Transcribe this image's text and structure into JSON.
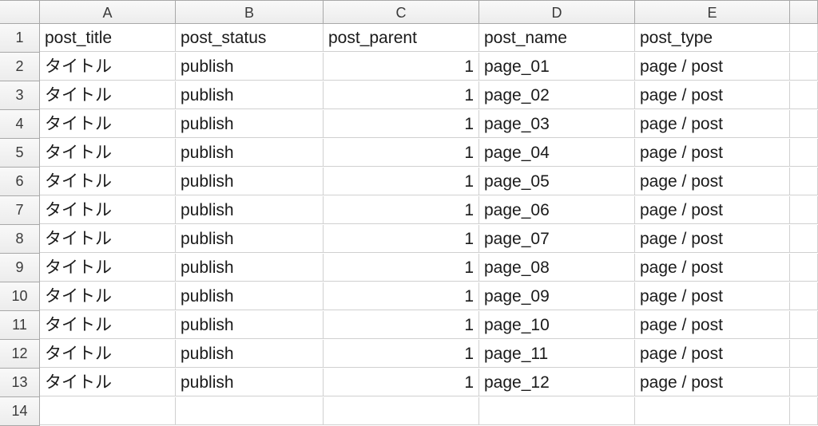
{
  "columns": [
    "A",
    "B",
    "C",
    "D",
    "E",
    ""
  ],
  "row_numbers": [
    "1",
    "2",
    "3",
    "4",
    "5",
    "6",
    "7",
    "8",
    "9",
    "10",
    "11",
    "12",
    "13",
    "14"
  ],
  "header_row": {
    "A": "post_title",
    "B": "post_status",
    "C": "post_parent",
    "D": "post_name",
    "E": "post_type"
  },
  "rows": [
    {
      "A": "タイトル",
      "B": "publish",
      "C": "1",
      "D": "page_01",
      "E": "page / post"
    },
    {
      "A": "タイトル",
      "B": "publish",
      "C": "1",
      "D": "page_02",
      "E": "page / post"
    },
    {
      "A": "タイトル",
      "B": "publish",
      "C": "1",
      "D": "page_03",
      "E": "page / post"
    },
    {
      "A": "タイトル",
      "B": "publish",
      "C": "1",
      "D": "page_04",
      "E": "page / post"
    },
    {
      "A": "タイトル",
      "B": "publish",
      "C": "1",
      "D": "page_05",
      "E": "page / post"
    },
    {
      "A": "タイトル",
      "B": "publish",
      "C": "1",
      "D": "page_06",
      "E": "page / post"
    },
    {
      "A": "タイトル",
      "B": "publish",
      "C": "1",
      "D": "page_07",
      "E": "page / post"
    },
    {
      "A": "タイトル",
      "B": "publish",
      "C": "1",
      "D": "page_08",
      "E": "page / post"
    },
    {
      "A": "タイトル",
      "B": "publish",
      "C": "1",
      "D": "page_09",
      "E": "page / post"
    },
    {
      "A": "タイトル",
      "B": "publish",
      "C": "1",
      "D": "page_10",
      "E": "page / post"
    },
    {
      "A": "タイトル",
      "B": "publish",
      "C": "1",
      "D": "page_11",
      "E": "page / post"
    },
    {
      "A": "タイトル",
      "B": "publish",
      "C": "1",
      "D": "page_12",
      "E": "page / post"
    }
  ]
}
